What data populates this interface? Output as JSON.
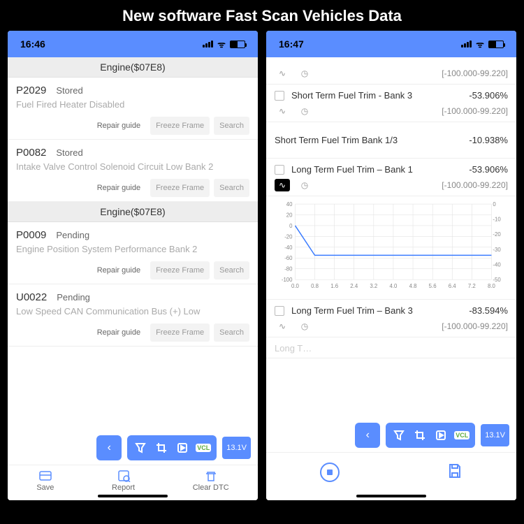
{
  "title": "New software Fast Scan Vehicles Data",
  "left": {
    "time": "16:46",
    "section1": "Engine($07E8)",
    "section2": "Engine($07E8)",
    "dtcs": [
      {
        "code": "P2029",
        "status": "Stored",
        "desc": "Fuel Fired Heater Disabled"
      },
      {
        "code": "P0082",
        "status": "Stored",
        "desc": "Intake Valve Control Solenoid Circuit Low Bank 2"
      },
      {
        "code": "P0009",
        "status": "Pending",
        "desc": "Engine Position System Performance Bank 2"
      },
      {
        "code": "U0022",
        "status": "Pending",
        "desc": "Low Speed CAN Communication Bus (+) Low"
      }
    ],
    "btn_repair": "Repair guide",
    "btn_freeze": "Freeze Frame",
    "btn_search": "Search",
    "voltage": "13.1V",
    "tab_save": "Save",
    "tab_report": "Report",
    "tab_clear": "Clear DTC"
  },
  "right": {
    "time": "16:47",
    "items": [
      {
        "chk": true,
        "name": "Short Term Fuel Trim - Bank 3",
        "val": "-53.906%",
        "range": "[-100.000-99.220]"
      },
      {
        "chk": false,
        "name": "Short Term Fuel Trim Bank 1/3",
        "val": "-10.938%",
        "range": ""
      },
      {
        "chk": true,
        "name": "Long Term Fuel Trim – Bank 1",
        "val": "-53.906%",
        "range": "[-100.000-99.220]"
      },
      {
        "chk": true,
        "name": "Long Term Fuel Trim – Bank 3",
        "val": "-83.594%",
        "range": "[-100.000-99.220]"
      }
    ],
    "range_top": "[-100.000-99.220]",
    "voltage": "13.1V"
  },
  "chart_data": {
    "type": "line",
    "x": [
      0.0,
      0.8,
      1.6,
      2.4,
      3.2,
      4.0,
      4.8,
      5.6,
      6.4,
      7.2,
      8.0
    ],
    "values": [
      0,
      -55,
      -55,
      -55,
      -55,
      -55,
      -55,
      -55,
      -55,
      -55,
      -55
    ],
    "y_ticks_left": [
      40,
      20,
      0,
      -20,
      -40,
      -60,
      -80,
      -100
    ],
    "y_ticks_right": [
      0,
      -10,
      -20,
      -30,
      -40,
      -50
    ],
    "ylim_left": [
      -100,
      40
    ],
    "ylim_right": [
      -50,
      0
    ],
    "xlim": [
      0.0,
      8.0
    ]
  }
}
